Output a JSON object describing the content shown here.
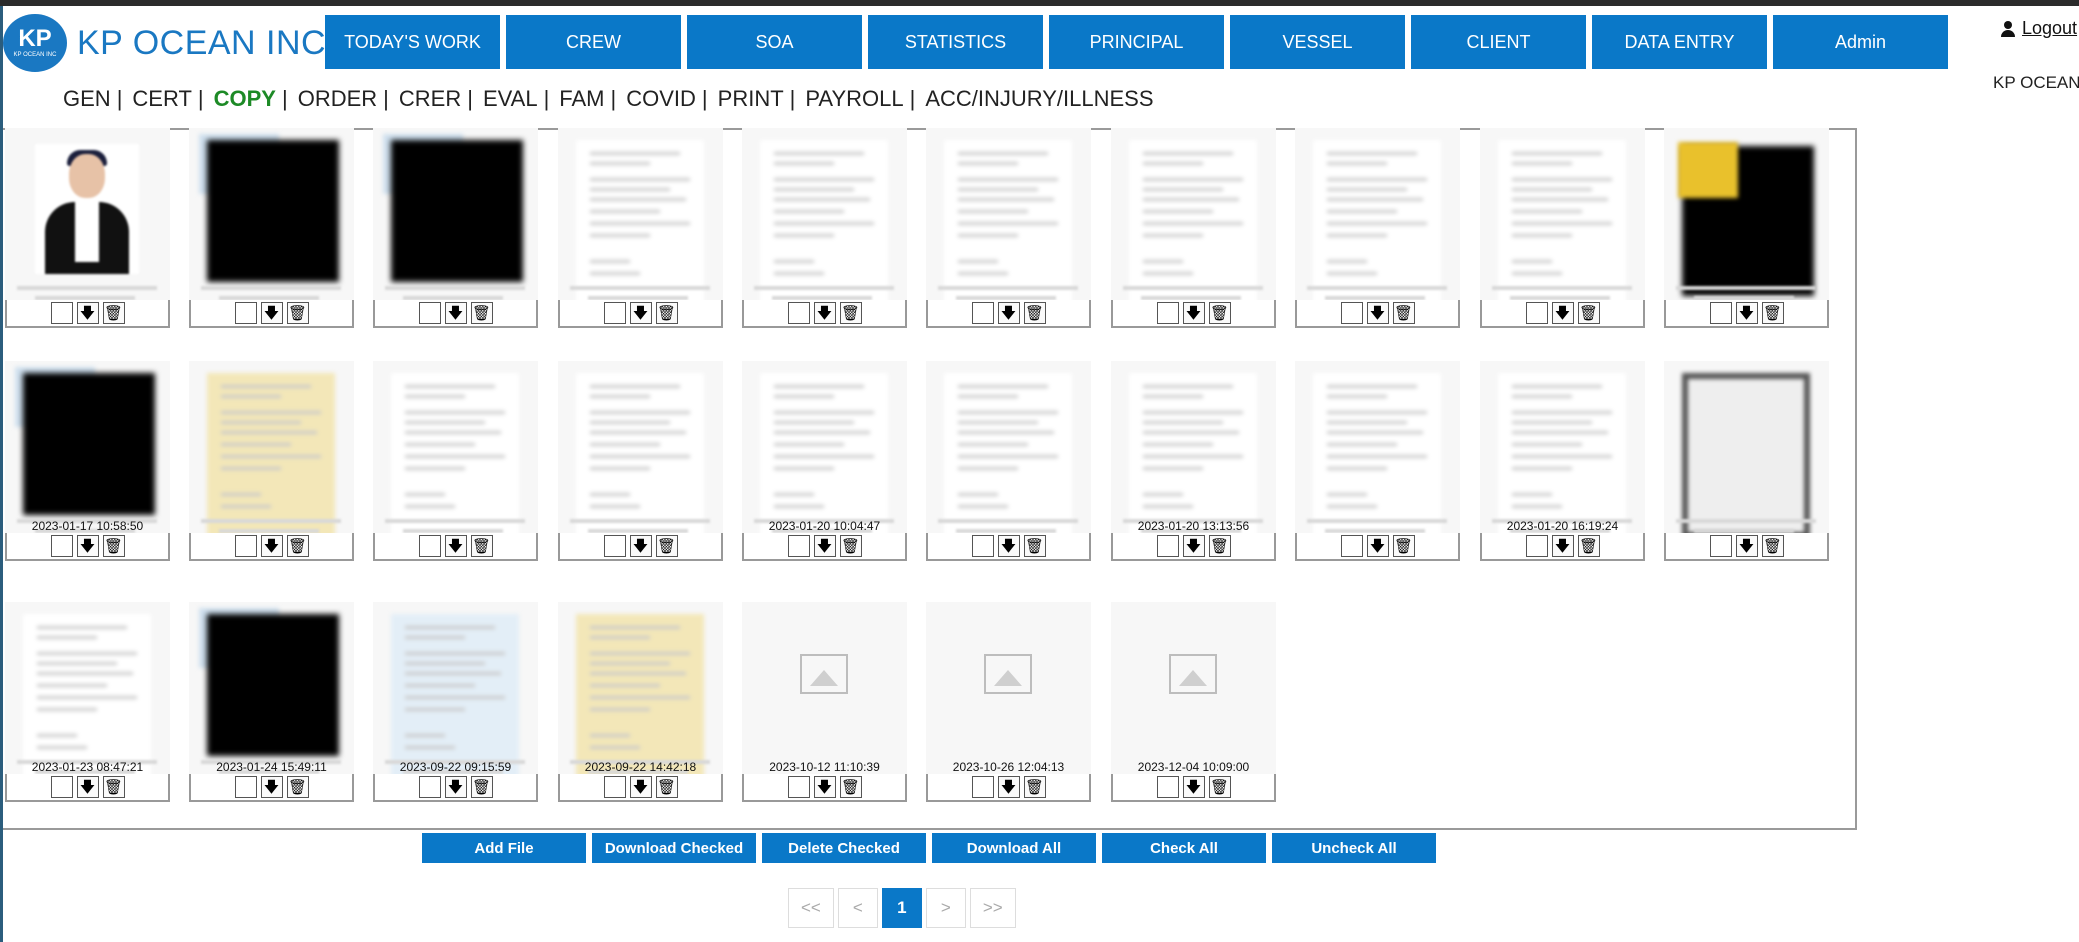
{
  "brand": {
    "logo_initials": "KP",
    "logo_sub": "KP OCEAN INC",
    "name": "KP OCEAN INC",
    "color": "#1a78c2"
  },
  "nav": [
    {
      "label": "TODAY'S WORK"
    },
    {
      "label": "CREW"
    },
    {
      "label": "SOA"
    },
    {
      "label": "STATISTICS"
    },
    {
      "label": "PRINCIPAL"
    },
    {
      "label": "VESSEL"
    },
    {
      "label": "CLIENT"
    },
    {
      "label": "DATA ENTRY"
    },
    {
      "label": "Admin"
    }
  ],
  "header": {
    "logout_label": "Logout",
    "user_icon": "user-icon",
    "company": "KP OCEAN"
  },
  "subnav": {
    "active": "COPY",
    "active_color": "#1d8a26",
    "tabs": [
      {
        "label": "GEN"
      },
      {
        "label": "CERT"
      },
      {
        "label": "COPY"
      },
      {
        "label": "ORDER"
      },
      {
        "label": "CRER"
      },
      {
        "label": "EVAL"
      },
      {
        "label": "FAM"
      },
      {
        "label": "COVID"
      },
      {
        "label": "PRINT"
      },
      {
        "label": "PAYROLL"
      },
      {
        "label": "ACC/INJURY/ILLNESS"
      }
    ]
  },
  "files": [
    {
      "kind": "photo",
      "date": ""
    },
    {
      "kind": "black",
      "date": ""
    },
    {
      "kind": "black",
      "date": ""
    },
    {
      "kind": "doc",
      "date": ""
    },
    {
      "kind": "doc",
      "date": ""
    },
    {
      "kind": "doc",
      "date": ""
    },
    {
      "kind": "doc",
      "date": ""
    },
    {
      "kind": "doc",
      "date": ""
    },
    {
      "kind": "doc",
      "date": ""
    },
    {
      "kind": "black-yellow",
      "date": ""
    },
    {
      "kind": "black",
      "date": "2023-01-17 10:58:50"
    },
    {
      "kind": "yellow-doc",
      "date": ""
    },
    {
      "kind": "doc",
      "date": ""
    },
    {
      "kind": "doc",
      "date": ""
    },
    {
      "kind": "doc",
      "date": "2023-01-20 10:04:47"
    },
    {
      "kind": "doc",
      "date": ""
    },
    {
      "kind": "doc",
      "date": "2023-01-20 13:13:56"
    },
    {
      "kind": "doc",
      "date": ""
    },
    {
      "kind": "doc",
      "date": "2023-01-20 16:19:24"
    },
    {
      "kind": "screen",
      "date": ""
    },
    {
      "kind": "doc",
      "date": "2023-01-23 08:47:21"
    },
    {
      "kind": "black",
      "date": "2023-01-24 15:49:11"
    },
    {
      "kind": "blue-doc",
      "date": "2023-09-22 09:15:59"
    },
    {
      "kind": "yellow-doc",
      "date": "2023-09-22 14:42:18"
    },
    {
      "kind": "placeholder",
      "date": "2023-10-12 11:10:39"
    },
    {
      "kind": "placeholder",
      "date": "2023-10-26 12:04:13"
    },
    {
      "kind": "placeholder",
      "date": "2023-12-04 10:09:00"
    }
  ],
  "file_controls": {
    "download_glyph": "🡇",
    "delete_glyph": "🗑",
    "download_icon": "download-icon",
    "delete_icon": "trash-icon"
  },
  "actions": [
    {
      "label": "Add File"
    },
    {
      "label": "Download Checked"
    },
    {
      "label": "Delete Checked"
    },
    {
      "label": "Download All"
    },
    {
      "label": "Check All"
    },
    {
      "label": "Uncheck All"
    }
  ],
  "pagination": {
    "first": "<<",
    "prev": "<",
    "current": "1",
    "next": ">",
    "last": ">>"
  },
  "colors": {
    "primary": "#0a78c8"
  }
}
